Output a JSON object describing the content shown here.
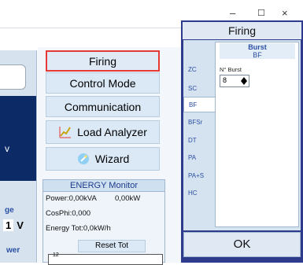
{
  "window": {
    "minimize_glyph": "–",
    "maximize_glyph": "☐",
    "close_glyph": "×"
  },
  "left": {
    "dark_text": "v",
    "label_age": "ge",
    "value_num": "1",
    "value_unit": "V",
    "label_wer": "wer"
  },
  "menu": {
    "firing": "Firing",
    "control_mode": "Control Mode",
    "communication": "Communication",
    "load_analyzer": "Load Analyzer",
    "wizard": "Wizard"
  },
  "energy": {
    "title": "ENERGY Monitor",
    "power": "Power:0,00kVA",
    "power_kw": "0,00kW",
    "cosphi": "CosPhi:0,000",
    "energy_tot": "Energy Tot:0,0kW/h",
    "reset": "Reset Tot",
    "graph_tick": "12"
  },
  "dialog": {
    "title": "Firing",
    "tabs": [
      "ZC",
      "SC",
      "BF",
      "BFSr",
      "DT",
      "PA",
      "PA+S",
      "HC"
    ],
    "active_tab": "BF",
    "content_title": "Burst",
    "content_sub": "BF",
    "nburst_label": "N° Burst",
    "nburst_value": "8",
    "ok": "OK"
  },
  "colors": {
    "dialog_frame": "#2e3a8c",
    "selected_border": "#e53935",
    "accent_text": "#2b4fa3"
  }
}
